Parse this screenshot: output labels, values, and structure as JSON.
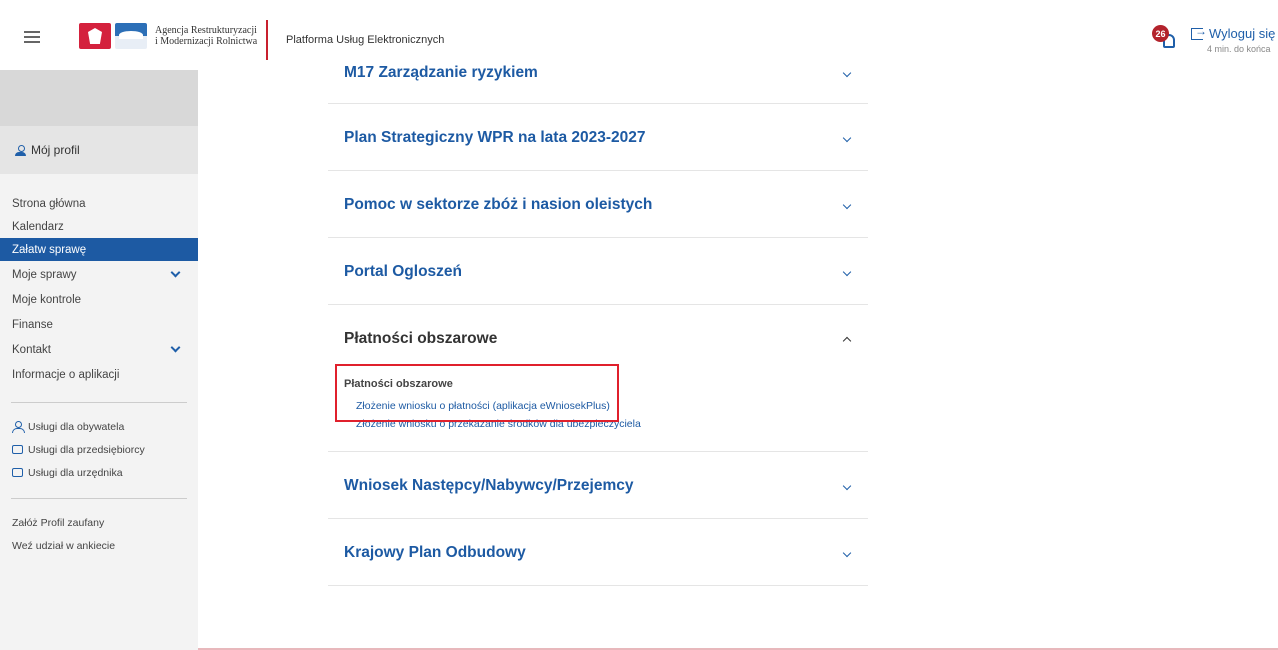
{
  "header": {
    "agency_line1": "Agencja Restrukturyzacji",
    "agency_line2": "i Modernizacji Rolnictwa",
    "platform_title": "Platforma Usług Elektronicznych",
    "notification_count": "26",
    "logout_label": "Wyloguj się",
    "session_remaining": "4 min. do końca",
    "accent_color": "#1d5aa3",
    "badge_color": "#b3232c"
  },
  "sidebar": {
    "profile_label": "Mój profil",
    "nav": [
      {
        "label": "Strona główna"
      },
      {
        "label": "Kalendarz"
      },
      {
        "label": "Załatw sprawę",
        "active": true
      },
      {
        "label": "Moje sprawy",
        "expandable": true
      },
      {
        "label": "Moje kontrole"
      },
      {
        "label": "Finanse"
      },
      {
        "label": "Kontakt",
        "expandable": true
      },
      {
        "label": "Informacje o aplikacji"
      }
    ],
    "services": [
      {
        "label": "Usługi dla obywatela",
        "icon": "person-icon"
      },
      {
        "label": "Usługi dla przedsiębiorcy",
        "icon": "briefcase-icon"
      },
      {
        "label": "Usługi dla urzędnika",
        "icon": "laptop-icon"
      }
    ],
    "extra": [
      {
        "label": "Załóż Profil zaufany"
      },
      {
        "label": "Weź udział w ankiecie"
      }
    ]
  },
  "main": {
    "sections": [
      {
        "title": "M17 Zarządzanie ryzykiem",
        "expanded": false
      },
      {
        "title": "Plan Strategiczny WPR na lata 2023-2027",
        "expanded": false
      },
      {
        "title": "Pomoc w sektorze zbóż i nasion oleistych",
        "expanded": false
      },
      {
        "title": "Portal Ogloszeń",
        "expanded": false
      },
      {
        "title": "Płatności obszarowe",
        "expanded": true,
        "sub_heading": "Płatności obszarowe",
        "links": [
          "Złożenie wniosku o płatności (aplikacja eWniosekPlus)",
          "Złożenie wniosku o przekazanie środków dla ubezpieczyciela"
        ]
      },
      {
        "title": "Wniosek Następcy/Nabywcy/Przejemcy",
        "expanded": false
      },
      {
        "title": "Krajowy Plan Odbudowy",
        "expanded": false
      }
    ]
  }
}
